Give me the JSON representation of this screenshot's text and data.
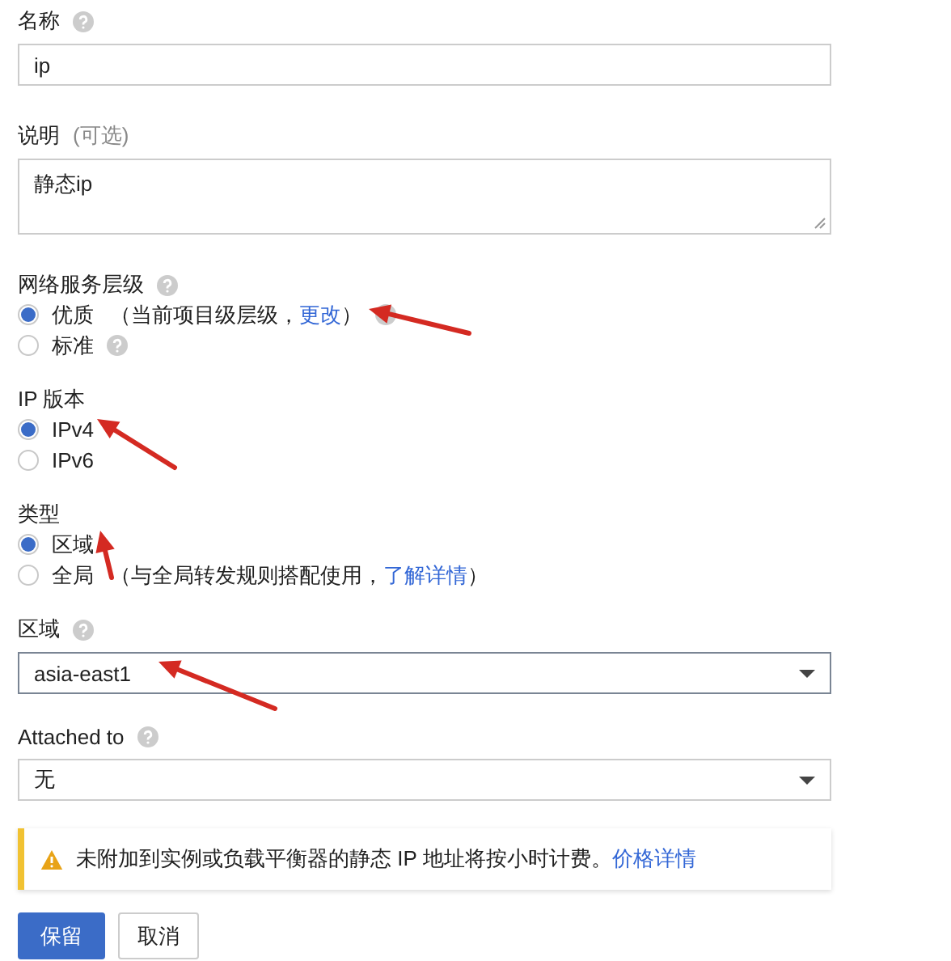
{
  "fields": [
    {
      "kind": "text",
      "label": "名称",
      "help": true,
      "value": "ip"
    },
    {
      "kind": "textarea",
      "label": "说明",
      "optional": "(可选)",
      "help": false,
      "value": "静态ip"
    },
    {
      "kind": "radio",
      "label": "网络服务层级",
      "help": true,
      "options": [
        {
          "label": "优质",
          "note": "（当前项目级层级，",
          "link": "更改",
          "note_end": "）",
          "help": true,
          "selected": true
        },
        {
          "label": "标准",
          "help": true,
          "selected": false
        }
      ]
    },
    {
      "kind": "radio",
      "label": "IP 版本",
      "help": false,
      "options": [
        {
          "label": "IPv4",
          "help": false,
          "selected": true
        },
        {
          "label": "IPv6",
          "help": false,
          "selected": false
        }
      ]
    },
    {
      "kind": "radio",
      "label": "类型",
      "help": false,
      "options": [
        {
          "label": "区域",
          "help": false,
          "selected": true
        },
        {
          "label": "全局",
          "note": "（与全局转发规则搭配使用，",
          "link": "了解详情",
          "note_end": "）",
          "help": false,
          "selected": false
        }
      ]
    },
    {
      "kind": "select",
      "label": "区域",
      "help": true,
      "value": "asia-east1",
      "focused": true
    },
    {
      "kind": "select",
      "label": "Attached to",
      "help": true,
      "value": "无",
      "focused": false
    }
  ],
  "warning": {
    "text": "未附加到实例或负载平衡器的静态 IP 地址将按小时计费。",
    "link": "价格详情"
  },
  "buttons": [
    {
      "label": "保留",
      "kind": "primary"
    },
    {
      "label": "取消",
      "kind": "secondary"
    }
  ]
}
